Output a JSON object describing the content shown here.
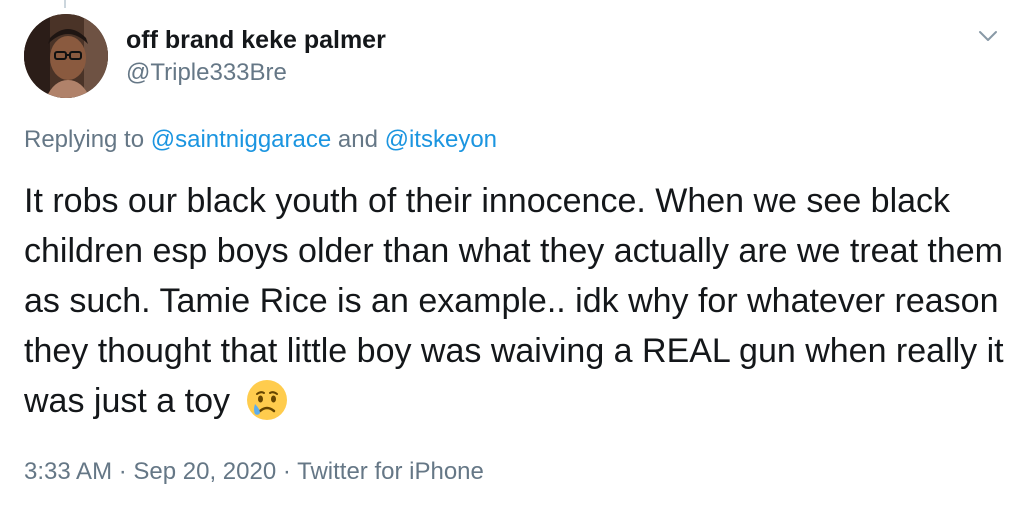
{
  "author": {
    "display_name": "off brand keke palmer",
    "handle": "@Triple333Bre"
  },
  "icons": {
    "menu": "chevron-down-icon",
    "emoji": "crying-face-emoji"
  },
  "reply": {
    "prefix": "Replying to",
    "mention1": "@saintniggarace",
    "conjunction": "and",
    "mention2": "@itskeyon"
  },
  "tweet": {
    "text": "It robs our black youth of their innocence. When we see black children esp boys older than what they actually are we treat them as such. Tamie Rice is an example.. idk why for whatever reason they thought that little boy was waiving a REAL gun when really it was just a toy",
    "emoji": "😢"
  },
  "meta": {
    "time": "3:33 AM",
    "separator": "·",
    "date": "Sep 20, 2020",
    "source": "Twitter for iPhone"
  },
  "colors": {
    "text": "#14171a",
    "secondary": "#657786",
    "link": "#1b95e0"
  }
}
